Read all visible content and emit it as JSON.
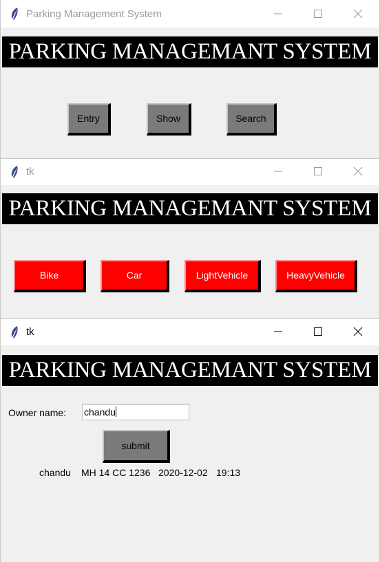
{
  "window1": {
    "title": "Parking Management System",
    "banner": "PARKING MANAGEMANT SYSTEM",
    "buttons": [
      {
        "label": "Entry"
      },
      {
        "label": "Show"
      },
      {
        "label": "Search"
      }
    ]
  },
  "window2": {
    "title": "tk",
    "banner": "PARKING MANAGEMANT SYSTEM",
    "buttons": [
      {
        "label": "Bike"
      },
      {
        "label": "Car"
      },
      {
        "label": "LightVehicle"
      },
      {
        "label": "HeavyVehicle"
      }
    ]
  },
  "window3": {
    "title": "tk",
    "banner": "PARKING MANAGEMANT SYSTEM",
    "owner_label": "Owner name:",
    "owner_value": "chandu",
    "submit_label": "submit",
    "result": {
      "owner": "chandu",
      "vehicle_number": "MH 14 CC 1236",
      "date": "2020-12-02",
      "time": "19:13"
    }
  },
  "icons": {
    "app": "feather-icon",
    "minimize": "minimize-icon",
    "maximize": "maximize-icon",
    "close": "close-icon"
  },
  "colors": {
    "banner_bg": "#000000",
    "banner_text": "#ffffff",
    "grey_button": "#7a7a7a",
    "red_button": "#ff0000",
    "window_bg": "#f0f0f0"
  }
}
